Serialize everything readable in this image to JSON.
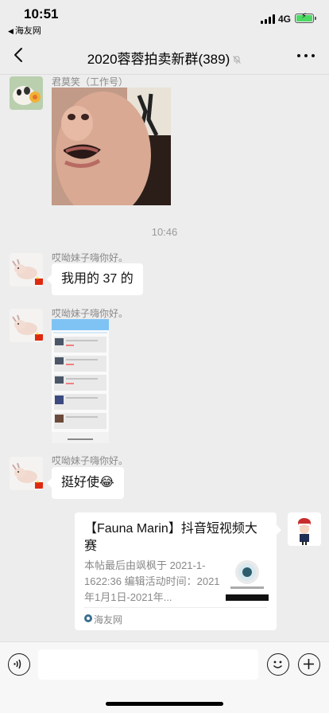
{
  "status_bar": {
    "time": "10:51",
    "back_app": "海友网",
    "network": "4G"
  },
  "header": {
    "title": "2020蓉蓉拍卖新群(389)",
    "muted_icon": "bell-off-icon",
    "more_icon": "more-icon",
    "back_icon": "chevron-left-icon"
  },
  "messages": [
    {
      "sender": "君莫笑（工作号）",
      "type": "image",
      "description_icon": "photo"
    },
    {
      "type": "time",
      "text": "10:46"
    },
    {
      "sender": "哎呦妹子嗨你好。",
      "type": "text",
      "text": "我用的 37 的"
    },
    {
      "sender": "哎呦妹子嗨你好。",
      "type": "image"
    },
    {
      "sender": "哎呦妹子嗨你好。",
      "type": "text",
      "text": "挺好使",
      "emoji": "😂"
    },
    {
      "type": "link",
      "title": "【Fauna Marin】抖音短视频大赛",
      "description": "本帖最后由飒枫于 2021-1-1622:36 编辑活动时间：2021年1月1日-2021年...",
      "source": "海友网"
    }
  ],
  "input_bar": {
    "voice_icon": "voice-icon",
    "emoji_icon": "emoji-icon",
    "plus_icon": "plus-icon"
  },
  "colors": {
    "background": "#ededed",
    "bubble": "#ffffff",
    "battery": "#4cd964",
    "flag_red": "#de2910"
  }
}
